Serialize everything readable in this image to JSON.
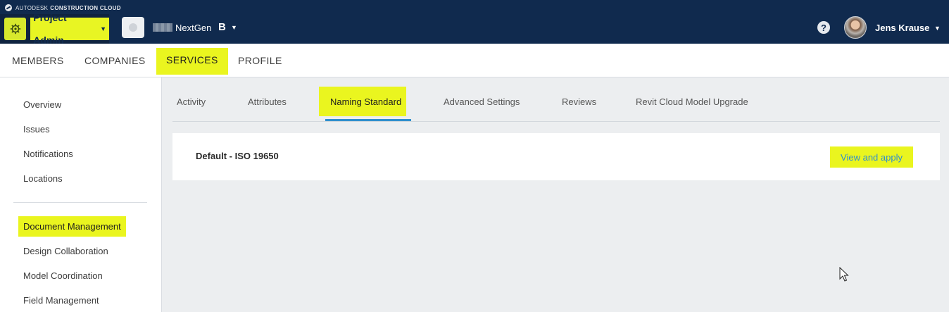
{
  "brand": {
    "light": "AUTODESK",
    "bold": "CONSTRUCTION CLOUD"
  },
  "topbar": {
    "module_label": "Project Admin",
    "project_name": "NextGen",
    "project_badge": "B",
    "help_symbol": "?",
    "user_name": "Jens Krause"
  },
  "main_tabs": [
    "MEMBERS",
    "COMPANIES",
    "SERVICES",
    "PROFILE"
  ],
  "sidebar": {
    "items": [
      "Overview",
      "Issues",
      "Notifications",
      "Locations",
      "Document Management",
      "Design Collaboration",
      "Model Coordination",
      "Field Management"
    ]
  },
  "sub_tabs": [
    "Activity",
    "Attributes",
    "Naming Standard",
    "Advanced Settings",
    "Reviews",
    "Revit Cloud Model Upgrade"
  ],
  "card": {
    "title": "Default - ISO 19650",
    "action_label": "View and apply"
  },
  "colors": {
    "header_bg": "#102a4e",
    "highlight": "#eaf51f",
    "accent_blue": "#2f8fce",
    "page_bg": "#eceef0"
  },
  "icons": {
    "module": "gear-icon",
    "help": "help-icon",
    "caret": "chevron-down-icon",
    "brand": "autodesk-logo-icon"
  }
}
